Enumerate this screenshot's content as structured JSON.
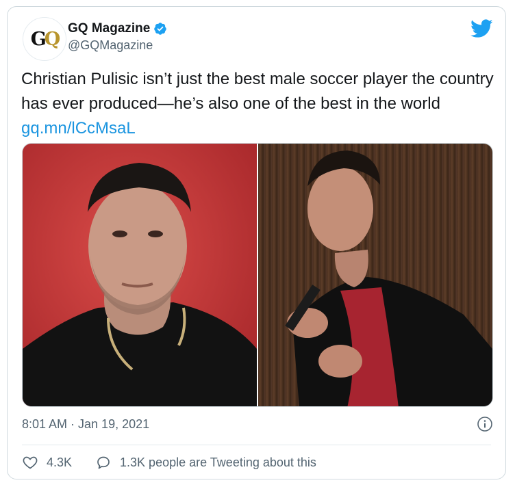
{
  "tweet": {
    "author": {
      "display_name": "GQ Magazine",
      "handle": "@GQMagazine",
      "avatar_text_g": "G",
      "avatar_text_q": "Q",
      "verified": true,
      "verified_icon": "verified-badge-icon",
      "brand_color": "#1da1f2"
    },
    "text": "Christian Pulisic isn’t just the best male soccer player the country has ever produced—he’s also one of the best in the world ",
    "link_text": "gq.mn/lCcMsaL",
    "timestamp": "8:01 AM · Jan 19, 2021",
    "stats": {
      "likes": "4.3K",
      "tweeting_about": "1.3K people are Tweeting about this"
    },
    "icons": {
      "logo": "twitter-bird-icon",
      "info": "info-icon",
      "like": "heart-icon",
      "reply": "speech-bubble-icon"
    },
    "colors": {
      "text": "#14171a",
      "secondary": "#536471",
      "link": "#1b95e0",
      "border": "#cfd9de"
    }
  }
}
